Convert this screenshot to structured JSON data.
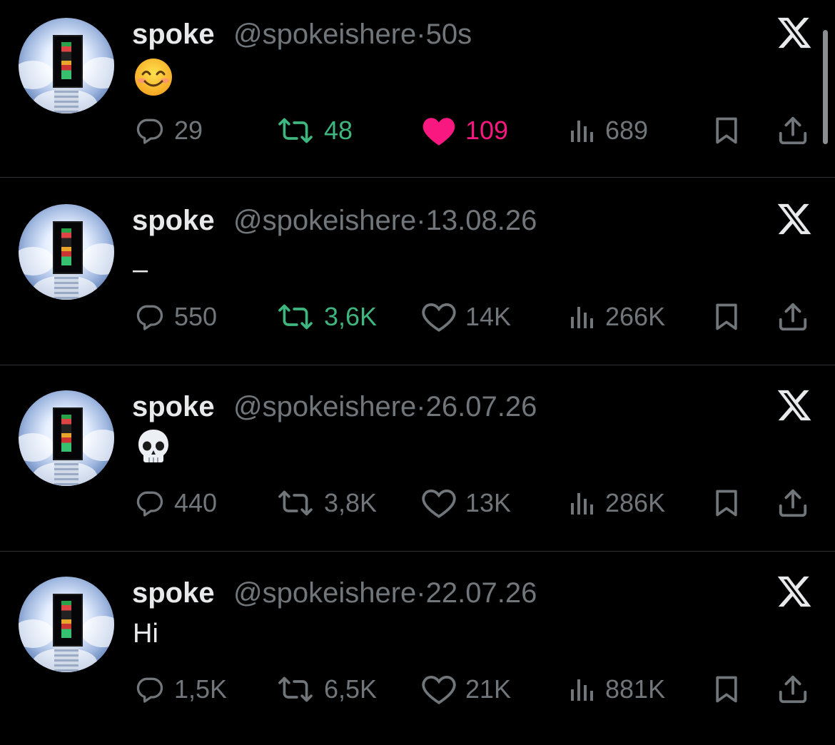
{
  "colors": {
    "background": "#000000",
    "text": "#e7e9ea",
    "muted": "#71767b",
    "retweet_active": "#3fb57f",
    "like_active": "#f91880",
    "divider": "#2f3336"
  },
  "tweets": [
    {
      "name": "spoke",
      "handle": "@spokeishere",
      "separator": "·",
      "time": "50s",
      "content_type": "emoji",
      "content_icon": "smiling-face-emoji",
      "content_text": "",
      "replies": "29",
      "retweets": "48",
      "likes": "109",
      "views": "689",
      "retweeted": true,
      "liked": true
    },
    {
      "name": "spoke",
      "handle": "@spokeishere",
      "separator": "·",
      "time": "13.08.26",
      "content_type": "text",
      "content_icon": "",
      "content_text": "–",
      "replies": "550",
      "retweets": "3,6K",
      "likes": "14K",
      "views": "266K",
      "retweeted": true,
      "liked": false
    },
    {
      "name": "spoke",
      "handle": "@spokeishere",
      "separator": "·",
      "time": "26.07.26",
      "content_type": "emoji",
      "content_icon": "skull-emoji",
      "content_text": "",
      "replies": "440",
      "retweets": "3,8K",
      "likes": "13K",
      "views": "286K",
      "retweeted": false,
      "liked": false
    },
    {
      "name": "spoke",
      "handle": "@spokeishere",
      "separator": "·",
      "time": "22.07.26",
      "content_type": "text",
      "content_icon": "",
      "content_text": "Hi",
      "replies": "1,5K",
      "retweets": "6,5K",
      "likes": "21K",
      "views": "881K",
      "retweeted": false,
      "liked": false
    }
  ]
}
